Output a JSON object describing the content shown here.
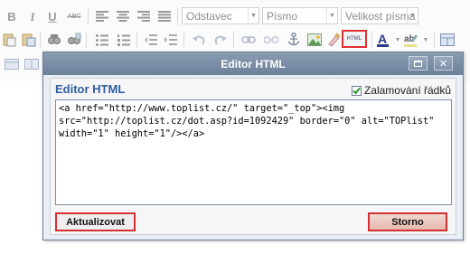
{
  "toolbar": {
    "paragraph_select": "Odstavec",
    "font_select": "Písmo",
    "size_select": "Velikost písma",
    "html_button_label": "HTML",
    "bold_label": "B",
    "italic_label": "I",
    "underline_label": "U",
    "strike_label": "ABC"
  },
  "dialog": {
    "title": "Editor HTML",
    "heading": "Editor HTML",
    "wrap_label": "Zalamování řádků",
    "wrap_checked": true,
    "code": "<a href=\"http://www.toplist.cz/\" target=\"_top\"><img src=\"http://toplist.cz/dot.asp?id=1092429\" border=\"0\" alt=\"TOPlist\" width=\"1\" height=\"1\"/></a>",
    "update_button": "Aktualizovat",
    "cancel_button": "Storno"
  },
  "colors": {
    "titlebar": "#7a8da6",
    "heading": "#2c5fa0",
    "highlight_border": "#e03030"
  }
}
